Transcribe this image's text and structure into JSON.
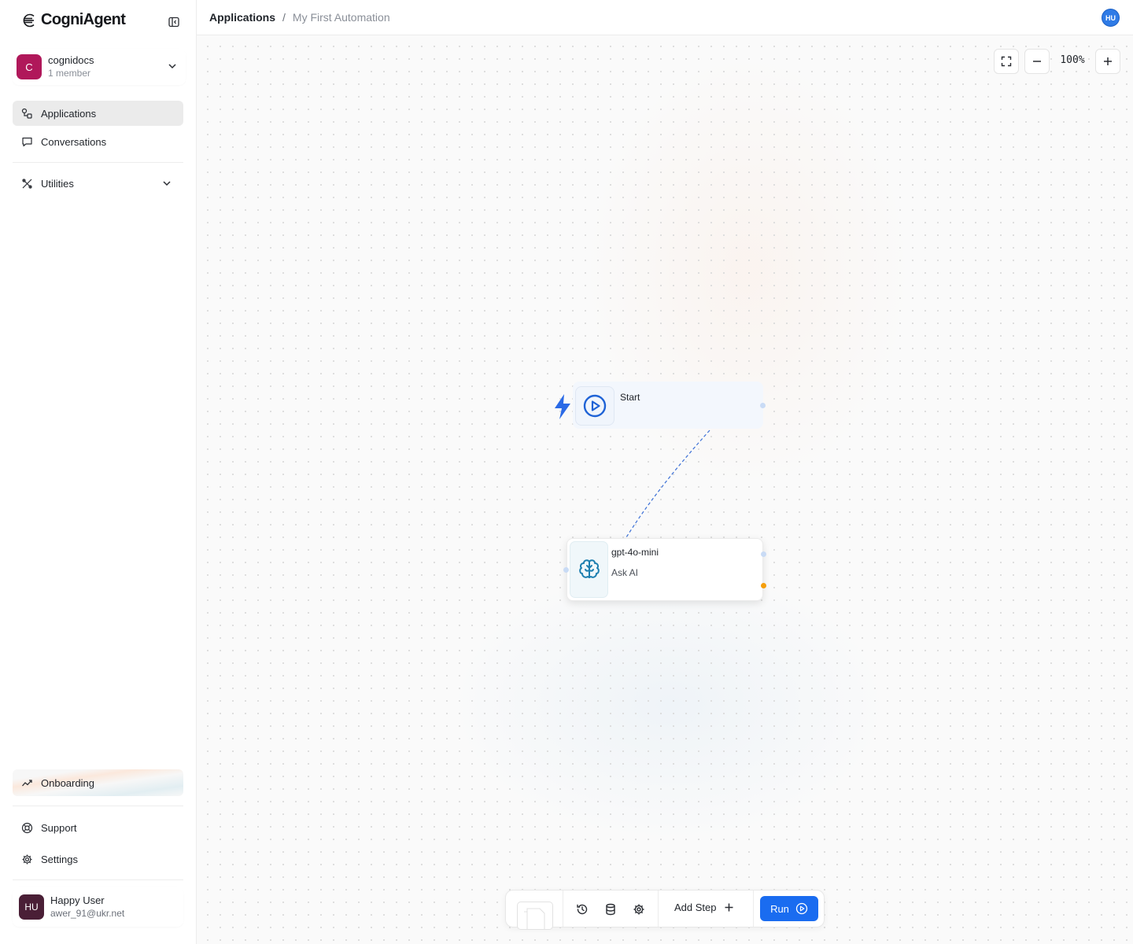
{
  "app": {
    "brand": "CogniAgent"
  },
  "workspace": {
    "initial": "C",
    "name": "cognidocs",
    "members": "1 member"
  },
  "nav": {
    "applications": "Applications",
    "conversations": "Conversations",
    "utilities": "Utilities",
    "onboarding": "Onboarding",
    "support": "Support",
    "settings": "Settings"
  },
  "user": {
    "initials": "HU",
    "name": "Happy User",
    "email": "awer_91@ukr.net"
  },
  "header": {
    "root": "Applications",
    "separator": "/",
    "current": "My First Automation",
    "avatar": "HU"
  },
  "canvas": {
    "zoom": "100%",
    "nodes": {
      "start": {
        "label": "Start"
      },
      "ai": {
        "model": "gpt-4o-mini",
        "action": "Ask AI"
      }
    }
  },
  "toolbar": {
    "add_step": "Add Step",
    "run": "Run"
  },
  "colors": {
    "accent": "#1a6cf0",
    "workspace_avatar": "#b0185a",
    "user_avatar": "#4a1f36",
    "node_handle_out": "#f59e0b"
  }
}
